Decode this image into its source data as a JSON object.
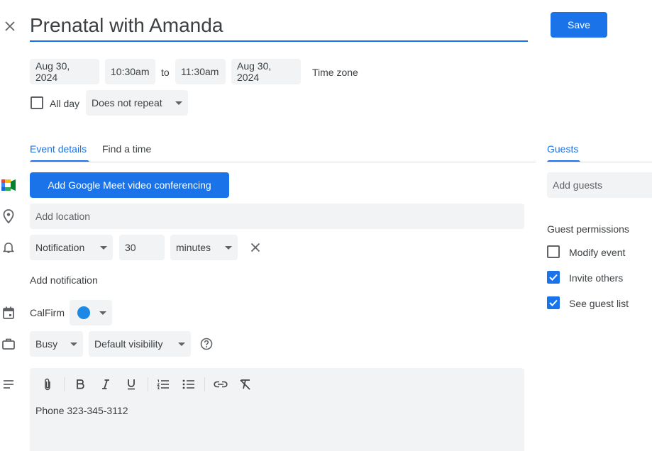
{
  "header": {
    "title": "Prenatal with Amanda",
    "save_label": "Save"
  },
  "datetime": {
    "start_date": "Aug 30, 2024",
    "start_time": "10:30am",
    "to_label": "to",
    "end_time": "11:30am",
    "end_date": "Aug 30, 2024",
    "timezone_label": "Time zone",
    "all_day_label": "All day",
    "all_day_checked": false,
    "repeat_value": "Does not repeat"
  },
  "tabs": {
    "event_details": "Event details",
    "find_time": "Find a time",
    "guests": "Guests"
  },
  "details": {
    "meet_button": "Add Google Meet video conferencing",
    "location_placeholder": "Add location",
    "notification_type": "Notification",
    "notification_amount": "30",
    "notification_unit": "minutes",
    "add_notification": "Add notification",
    "calendar_name": "CalFirm",
    "calendar_color": "#1e88e5",
    "availability": "Busy",
    "visibility": "Default visibility",
    "description": "Phone 323-345-3112"
  },
  "guests": {
    "add_placeholder": "Add guests",
    "permissions_title": "Guest permissions",
    "permissions": [
      {
        "label": "Modify event",
        "checked": false
      },
      {
        "label": "Invite others",
        "checked": true
      },
      {
        "label": "See guest list",
        "checked": true
      }
    ]
  },
  "colors": {
    "accent": "#1a73e8",
    "chip_bg": "#f1f3f4"
  }
}
